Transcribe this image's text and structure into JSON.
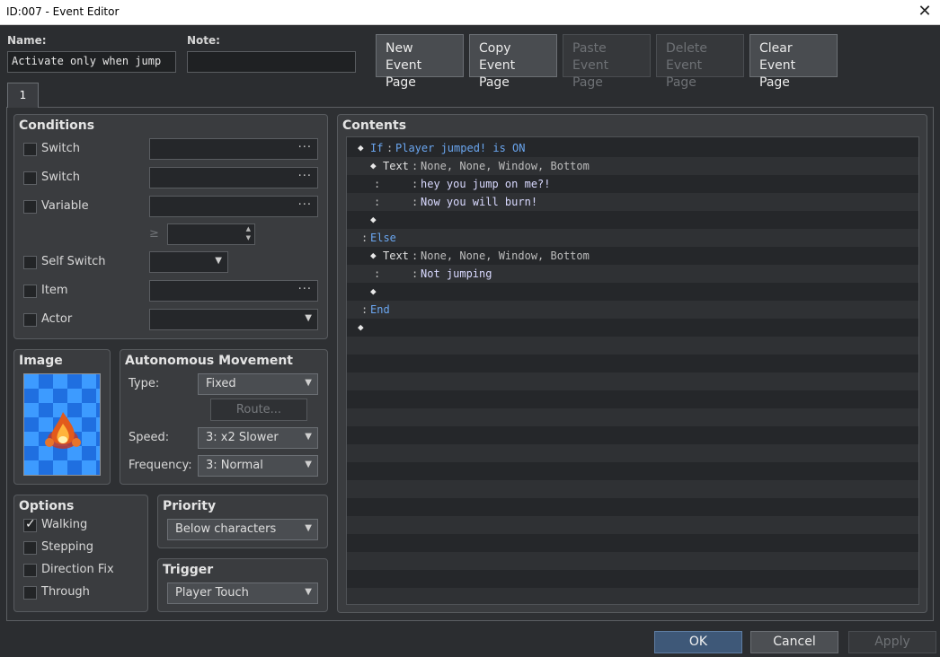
{
  "window": {
    "title": "ID:007 - Event Editor",
    "close_glyph": "✕"
  },
  "header": {
    "name_label": "Name:",
    "name_value": "Activate only when jump",
    "note_label": "Note:",
    "note_value": ""
  },
  "toolbar": {
    "new_line1": "New",
    "new_line2": "Event Page",
    "copy_line1": "Copy",
    "copy_line2": "Event Page",
    "paste_line1": "Paste",
    "paste_line2": "Event Page",
    "delete_line1": "Delete",
    "delete_line2": "Event Page",
    "clear_line1": "Clear",
    "clear_line2": "Event Page"
  },
  "tabs": [
    {
      "label": "1"
    }
  ],
  "conditions": {
    "title": "Conditions",
    "switch1_label": "Switch",
    "switch2_label": "Switch",
    "variable_label": "Variable",
    "gte_symbol": "≥",
    "self_switch_label": "Self Switch",
    "item_label": "Item",
    "actor_label": "Actor",
    "dots": "···"
  },
  "image": {
    "title": "Image"
  },
  "movement": {
    "title": "Autonomous Movement",
    "type_label": "Type:",
    "type_value": "Fixed",
    "route_label": "Route...",
    "speed_label": "Speed:",
    "speed_value": "3: x2 Slower",
    "frequency_label": "Frequency:",
    "frequency_value": "3: Normal"
  },
  "options": {
    "title": "Options",
    "walking": "Walking",
    "stepping": "Stepping",
    "direction_fix": "Direction Fix",
    "through": "Through"
  },
  "priority": {
    "title": "Priority",
    "value": "Below characters"
  },
  "trigger": {
    "title": "Trigger",
    "value": "Player Touch"
  },
  "contents": {
    "title": "Contents",
    "lines": {
      "l0_kw": "If",
      "l0_sep": ":",
      "l0_cond": "Player jumped! is ON",
      "l1_cmd": "Text",
      "l1_sep": ":",
      "l1_args": "None, None, Window, Bottom",
      "l2_colon": ":",
      "l2_sep": ":",
      "l2_text": "hey you jump on me?!",
      "l3_colon": ":",
      "l3_sep": ":",
      "l3_text": "Now you will burn!",
      "l5_sep": ":",
      "l5_kw": "Else",
      "l6_cmd": "Text",
      "l6_sep": ":",
      "l6_args": "None, None, Window, Bottom",
      "l7_colon": ":",
      "l7_sep": ":",
      "l7_text": "Not jumping",
      "l9_sep": ":",
      "l9_kw": "End"
    }
  },
  "footer": {
    "ok": "OK",
    "cancel": "Cancel",
    "apply": "Apply"
  }
}
